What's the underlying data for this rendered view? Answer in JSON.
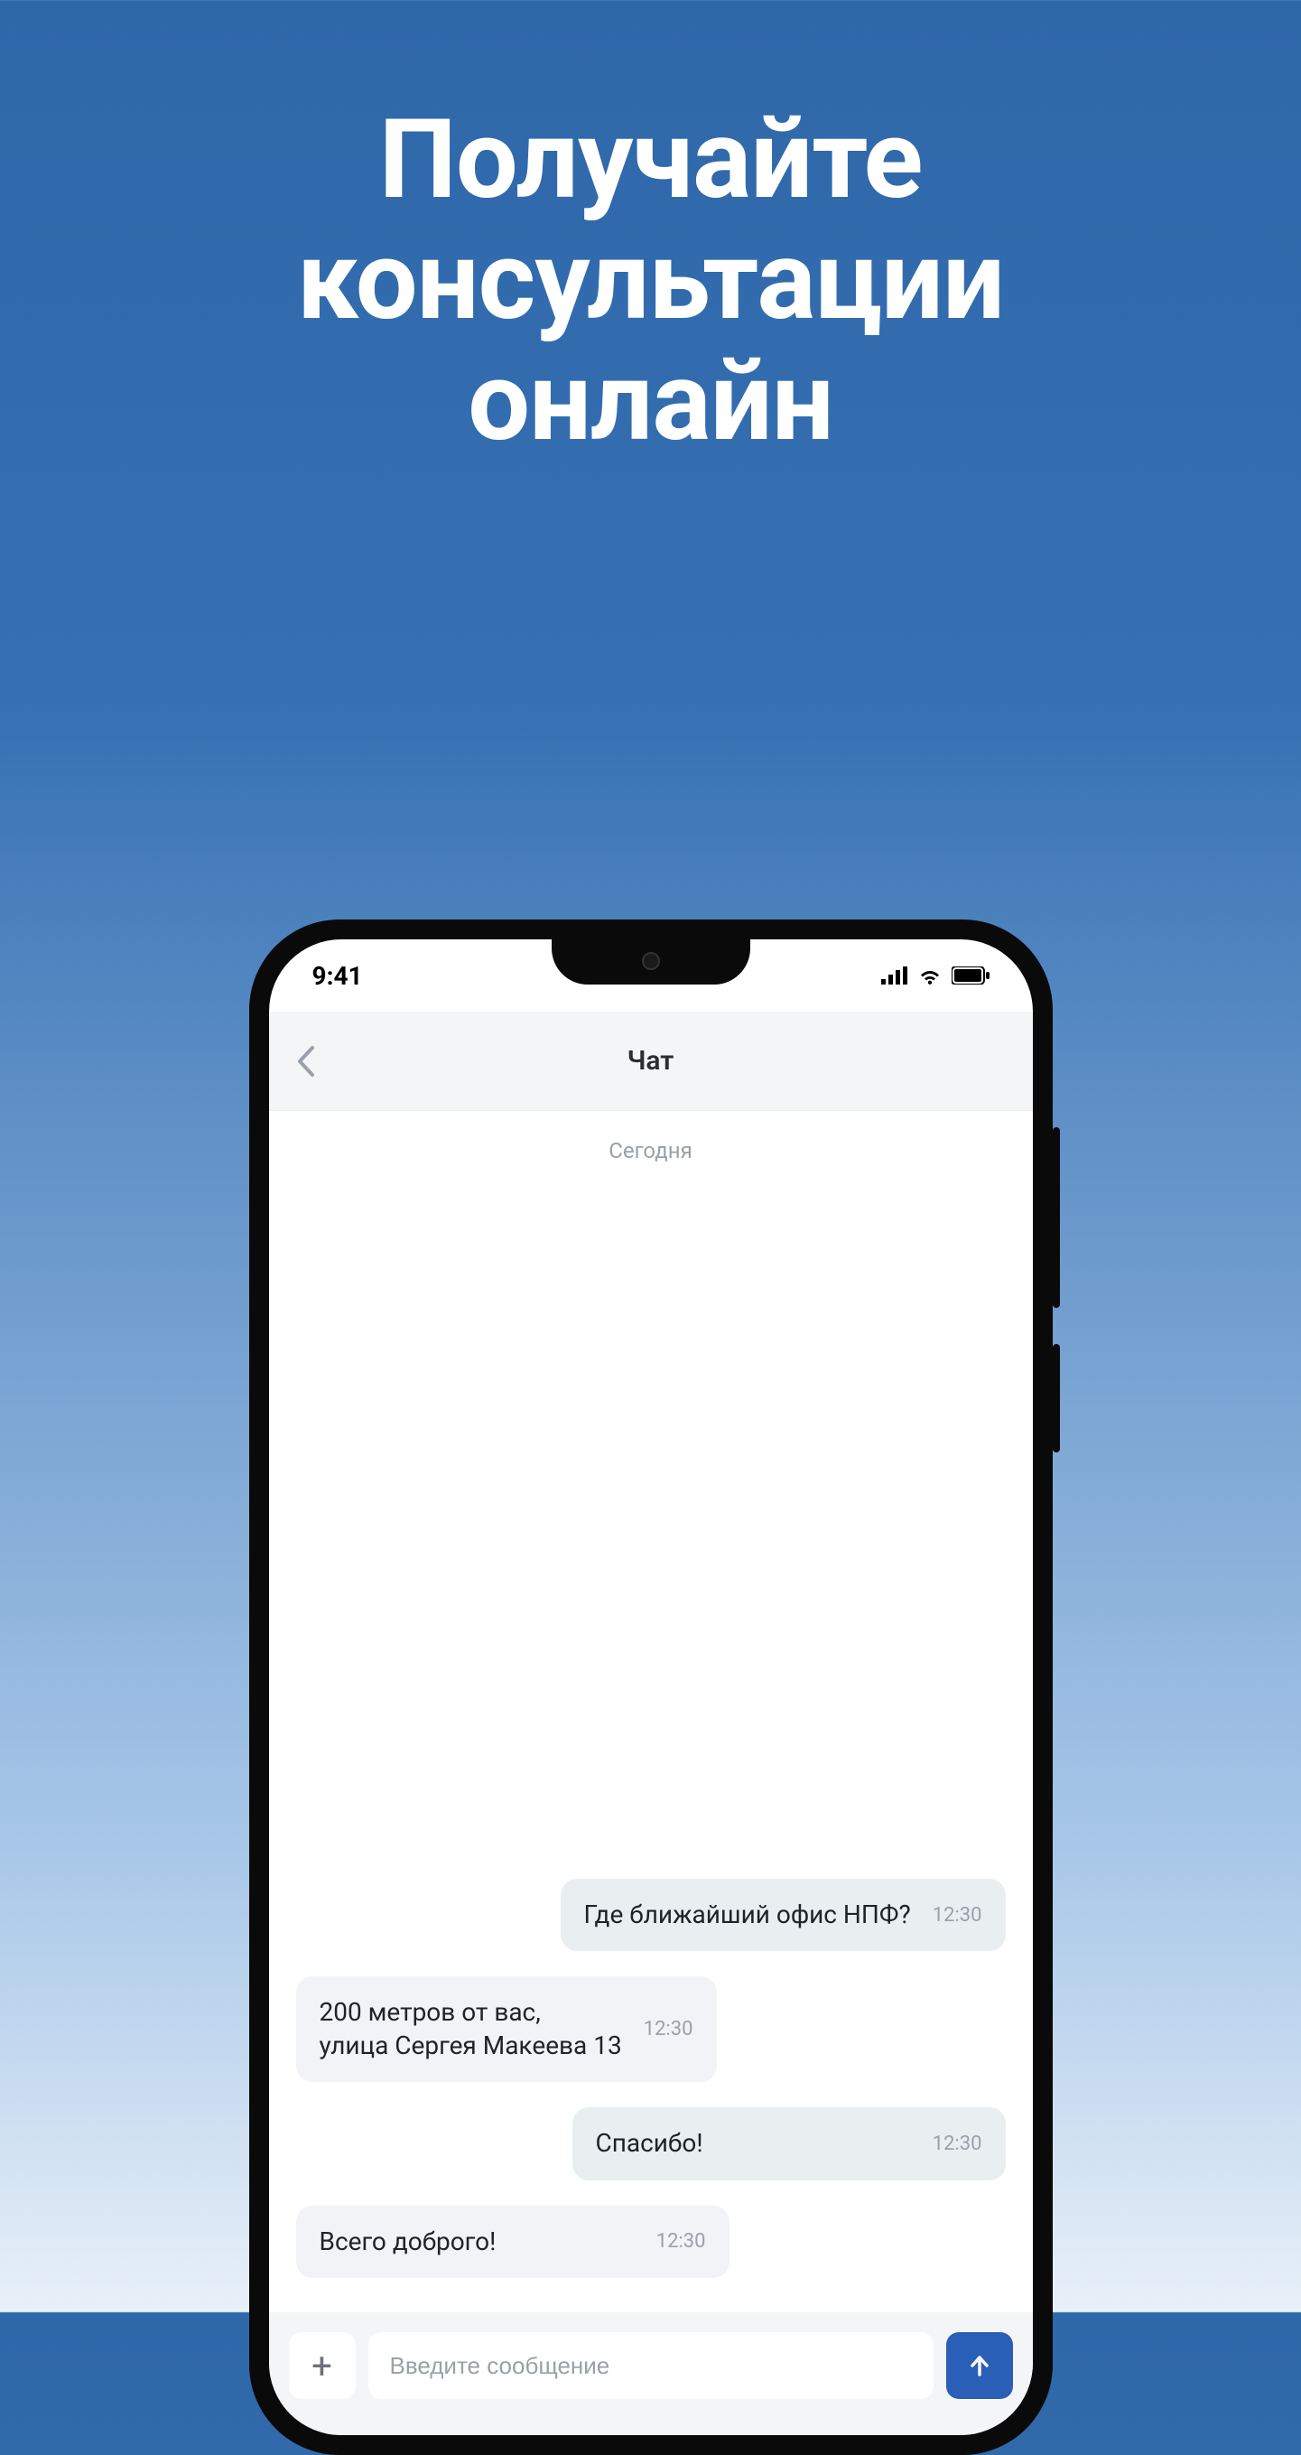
{
  "hero": {
    "title_line1": "Получайте",
    "title_line2": "консультации",
    "title_line3": "онлайн"
  },
  "status": {
    "time": "9:41"
  },
  "header": {
    "title": "Чат"
  },
  "date_separator": "Сегодня",
  "messages": [
    {
      "dir": "outgoing",
      "text": "Где ближайший офис НПФ?",
      "time": "12:30"
    },
    {
      "dir": "incoming",
      "text": "200 метров от вас,\nулица Сергея Макеева 13",
      "time": "12:30"
    },
    {
      "dir": "outgoing",
      "text": "Спасибо!",
      "time": "12:30"
    },
    {
      "dir": "incoming",
      "text": "Всего доброго!",
      "time": "12:30"
    }
  ],
  "input": {
    "placeholder": "Введите сообщение"
  }
}
